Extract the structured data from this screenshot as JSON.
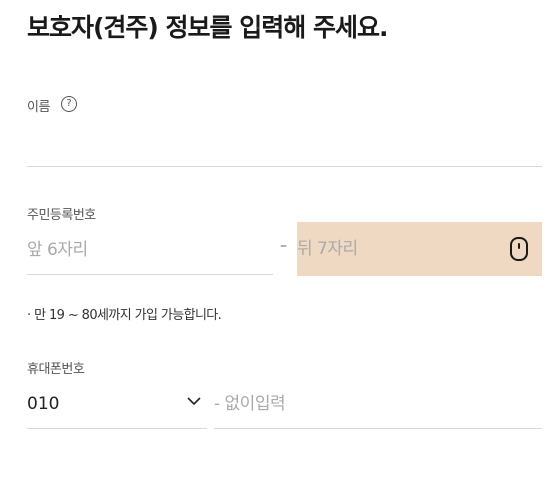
{
  "page": {
    "title": "보호자(견주) 정보를 입력해 주세요."
  },
  "name_field": {
    "label": "이름",
    "help_icon": "question-circle-icon",
    "value": ""
  },
  "resident_number": {
    "label": "주민등록번호",
    "front_placeholder": "앞 6자리",
    "separator": "–",
    "back_placeholder": "뒤 7자리",
    "back_highlight_color": "#f0d9c2",
    "keypad_icon": "mouse-icon"
  },
  "notice": {
    "text": "· 만 19 ~ 80세까지 가입 가능합니다."
  },
  "phone": {
    "label": "휴대폰번호",
    "carrier_value": "010",
    "carrier_icon": "chevron-down-icon",
    "number_placeholder": "- 없이입력"
  }
}
